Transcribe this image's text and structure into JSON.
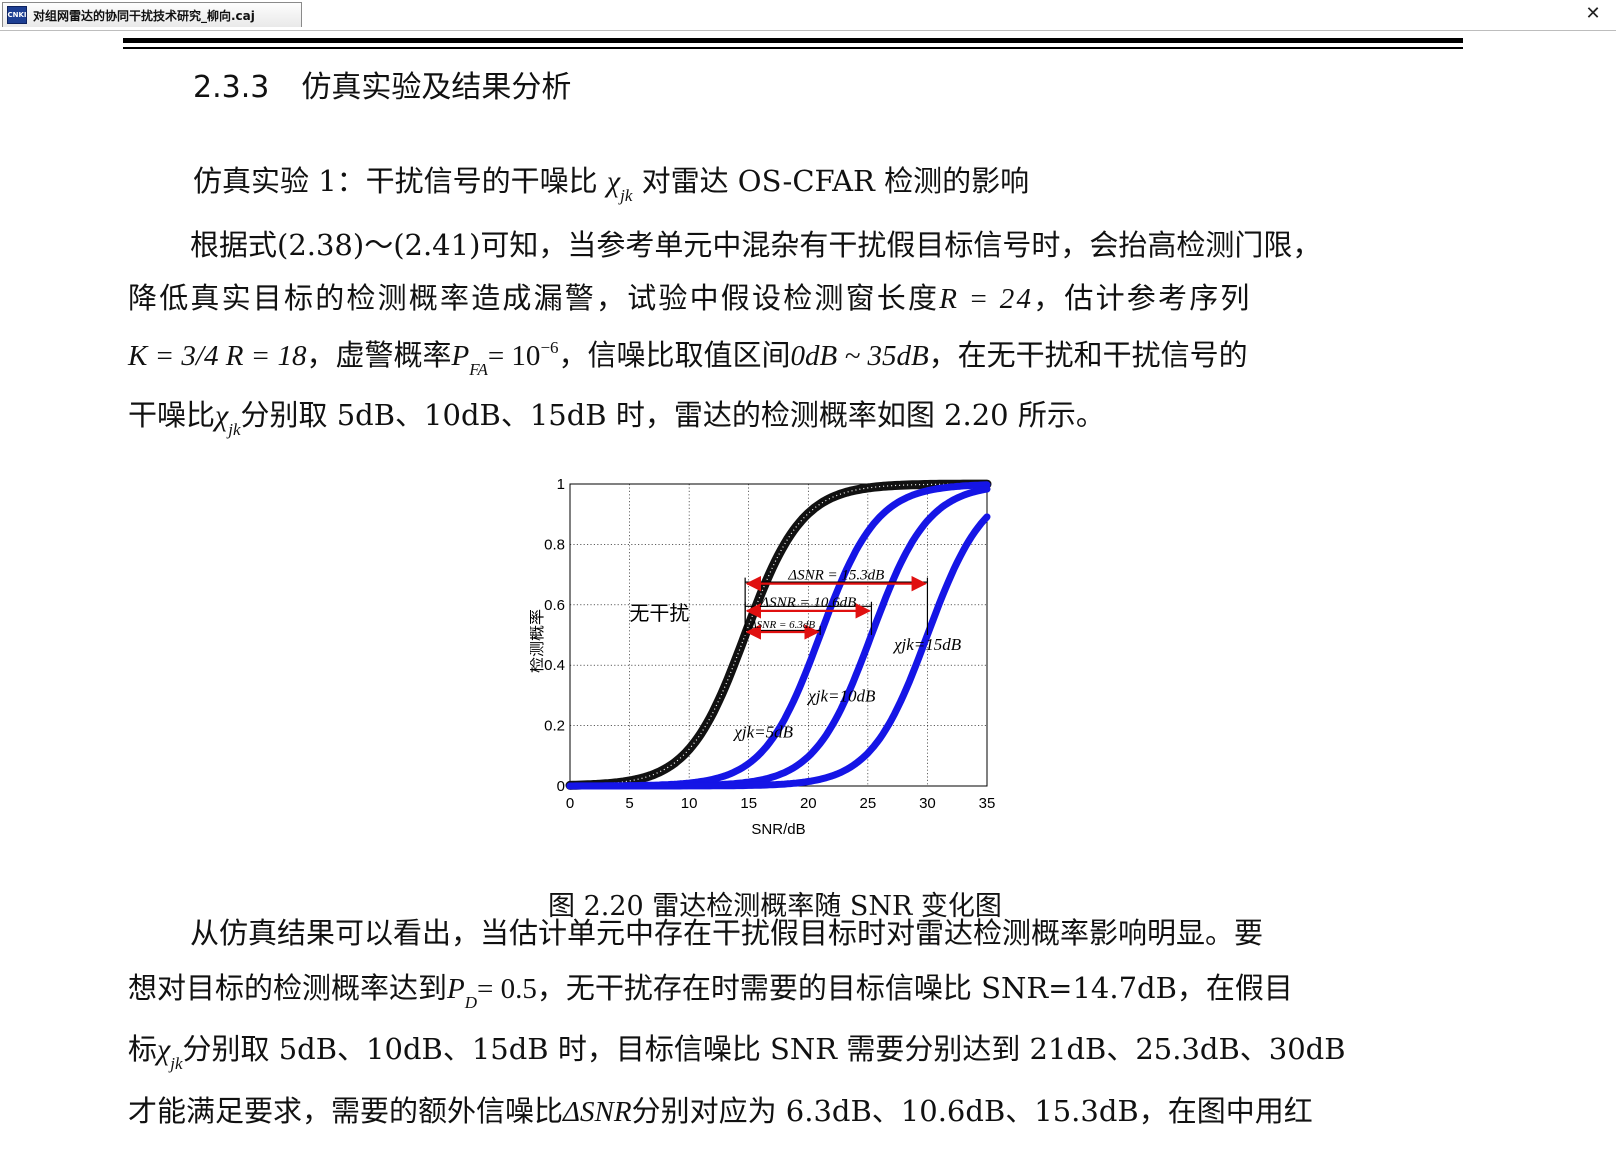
{
  "window": {
    "tab_title": "对组网雷达的协同干扰技术研究_柳向.caj",
    "app_icon_text": "CNKI",
    "close_glyph": "✕"
  },
  "section": {
    "number": "2.3.3",
    "title": "仿真实验及结果分析"
  },
  "experiment": {
    "lead": "仿真实验 1：干扰信号的干噪比",
    "chi": "χ",
    "chi_sub": "jk",
    "tail": "对雷达 OS-CFAR 检测的影响"
  },
  "paragraph1": {
    "line1": "根据式(2.38)～(2.41)可知，当参考单元中混杂有干扰假目标信号时，会抬高检测门限，",
    "line2_a": "降低真实目标的检测概率造成漏警，试验中假设检测窗长度",
    "line2_math": "R = 24",
    "line2_b": "，估计参考序列",
    "line3_math1": "K = 3/4 R = 18",
    "line3_a": "，虚警概率",
    "line3_pfa": "P",
    "line3_pfa_sub": "FA",
    "line3_pfa_val": "= 10",
    "line3_pfa_exp": "−6",
    "line3_b": "，信噪比取值区间",
    "line3_range": "0dB ~ 35dB",
    "line3_c": "，在无干扰和干扰信号的",
    "line4_a": "干噪比",
    "line4_b": "分别取 5dB、10dB、15dB 时，雷达的检测概率如图 2.20 所示。"
  },
  "figure": {
    "caption": "图 2.20    雷达检测概率随 SNR 变化图"
  },
  "paragraph2": {
    "line1": "从仿真结果可以看出，当估计单元中存在干扰假目标时对雷达检测概率影响明显。要",
    "line2_a": "想对目标的检测概率达到",
    "line2_pd": "P",
    "line2_pd_sub": "D",
    "line2_pd_val": "= 0.5",
    "line2_b": "，无干扰存在时需要的目标信噪比 SNR=14.7dB，在假目",
    "line3_a": "标",
    "line3_b": "分别取 5dB、10dB、15dB 时，目标信噪比 SNR 需要分别达到 21dB、25.3dB、30dB",
    "line4_a": "才能满足要求，需要的额外信噪比",
    "line4_delta": "ΔSNR",
    "line4_b": "分别对应为 6.3dB、10.6dB、15.3dB，在图中用红"
  },
  "chart_data": {
    "type": "line",
    "xlabel": "SNR/dB",
    "ylabel": "检测概率",
    "xlim": [
      0,
      35
    ],
    "ylim": [
      0,
      1
    ],
    "xticks": [
      0,
      5,
      10,
      15,
      20,
      25,
      30,
      35
    ],
    "yticks": [
      0,
      0.2,
      0.4,
      0.6,
      0.8,
      1
    ],
    "ytick_labels": [
      "0",
      "0.2",
      "0.4",
      "0.6",
      "0.8",
      "1"
    ],
    "grid": true,
    "series": [
      {
        "name": "无干扰",
        "color": "#111111",
        "marker": "star",
        "pd50": 14.7
      },
      {
        "name": "χjk=5dB",
        "color": "#1515e6",
        "marker": "dot",
        "pd50": 21.0
      },
      {
        "name": "χjk=10dB",
        "color": "#1515e6",
        "marker": "dot",
        "pd50": 25.3
      },
      {
        "name": "χjk=15dB",
        "color": "#1515e6",
        "marker": "dot",
        "pd50": 30.0
      }
    ],
    "curve_labels": [
      {
        "text": "无干扰",
        "at_x": 7.5,
        "at_y": 0.55
      },
      {
        "text": "χjk=15dB",
        "chi_sub": "jk",
        "at_x": 27.2,
        "at_y": 0.45
      },
      {
        "text": "χjk=10dB",
        "chi_sub": "jk",
        "at_x": 20.0,
        "at_y": 0.28
      },
      {
        "text": "χjk=5dB",
        "chi_sub": "jk",
        "at_x": 13.8,
        "at_y": 0.16
      }
    ],
    "annotations": [
      {
        "label": "ΔSNR = 15.3dB",
        "from": 14.7,
        "to": 30.0,
        "y": 0.67,
        "tick_top": 0.69
      },
      {
        "label": "ΔSNR = 10.6dB",
        "from": 14.7,
        "to": 25.3,
        "y": 0.58,
        "tick_top": 0.61
      },
      {
        "label": "ΔSNR = 6.3dB",
        "from": 14.7,
        "to": 21.0,
        "y": 0.51,
        "tick_top": 0.53
      }
    ],
    "annotation_color": "#e01010"
  }
}
